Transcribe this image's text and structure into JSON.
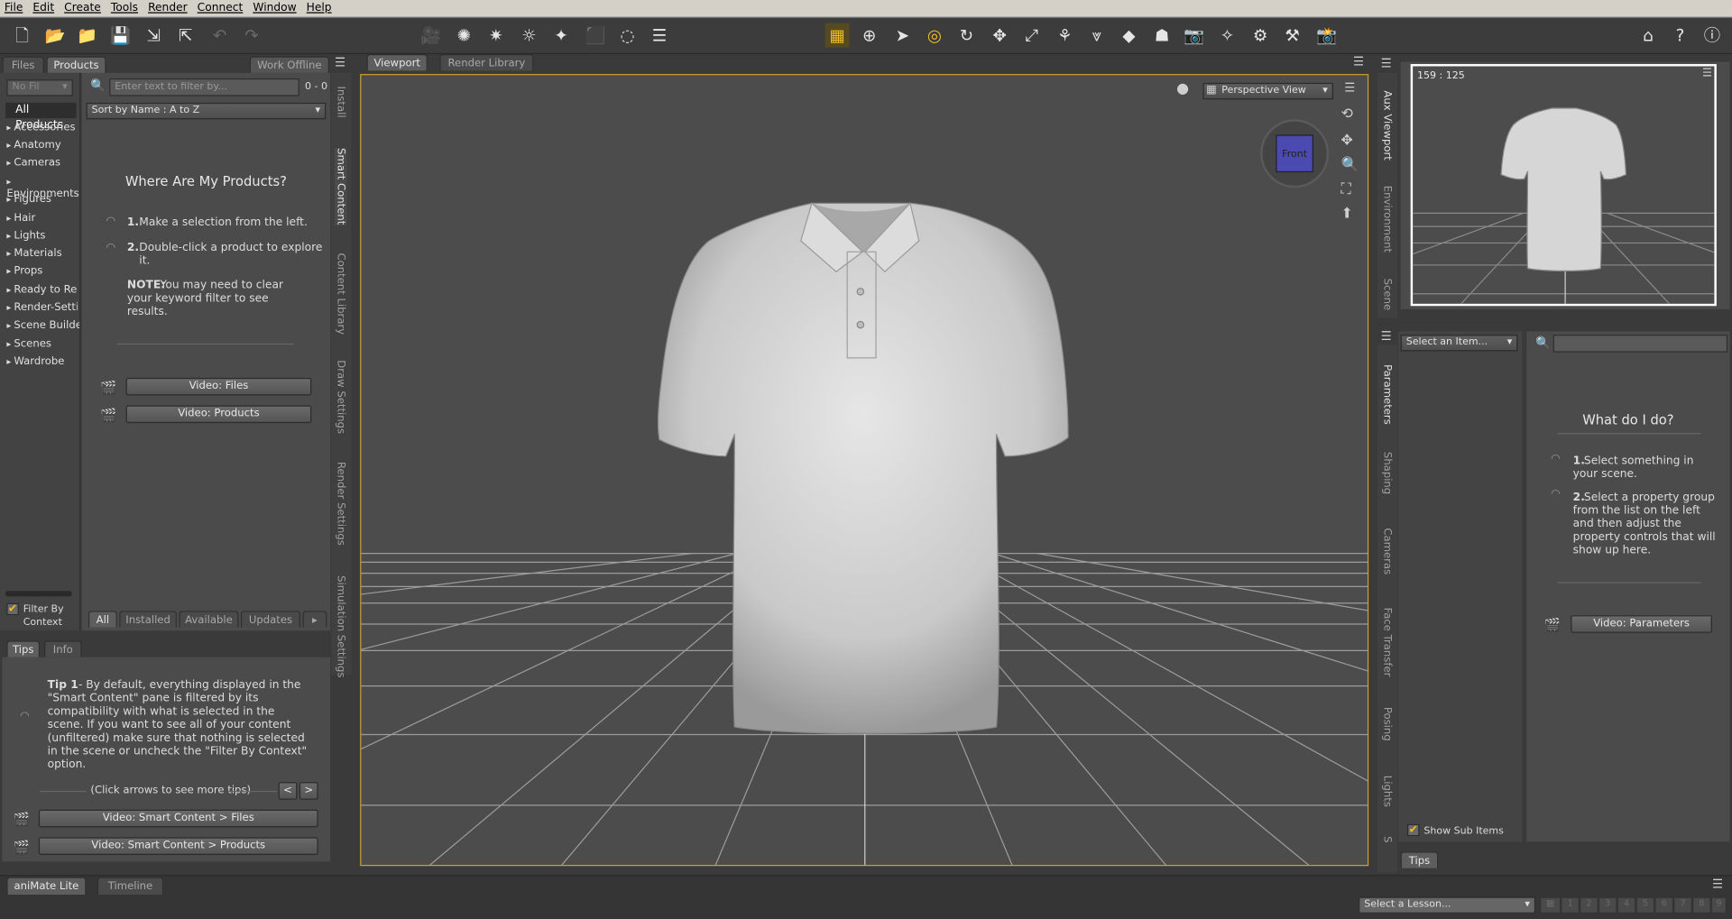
{
  "menu": [
    "File",
    "Edit",
    "Create",
    "Tools",
    "Render",
    "Connect",
    "Window",
    "Help"
  ],
  "left_tabs": {
    "files": "Files",
    "products": "Products",
    "work_offline": "Work Offline"
  },
  "left": {
    "filter_placeholder": "Enter text to filter by...",
    "filter_count": "0 - 0",
    "no_filter": "No Fil",
    "all_products": "All Products",
    "sort": "Sort by Name : A to Z",
    "categories": [
      "Accessories",
      "Anatomy",
      "Cameras",
      "Environments",
      "Figures",
      "Hair",
      "Lights",
      "Materials",
      "Props",
      "Ready to Ren",
      "Render-Settin",
      "Scene Builder",
      "Scenes",
      "Wardrobe"
    ],
    "where_title": "Where Are My Products?",
    "step1_num": "1.",
    "step1": "Make a selection from the left.",
    "step2_num": "2.",
    "step2": "Double-click a product to explore it.",
    "note_label": "NOTE:",
    "note": "You may need to clear your keyword filter to see results.",
    "video_files": "Video: Files",
    "video_products": "Video: Products",
    "filter_by": "Filter By",
    "context": "Context",
    "bottom_tabs": [
      "All",
      "Installed",
      "Available",
      "Updates"
    ]
  },
  "left_vtabs": [
    "Install",
    "Smart Content",
    "Content Library",
    "Draw Settings",
    "Render Settings",
    "Simulation Settings"
  ],
  "tips": {
    "tab_tips": "Tips",
    "tab_info": "Info",
    "tip_label": "Tip 1",
    "tip_text": "- By default, everything displayed in the \"Smart Content\" pane is filtered by its compatibility with what is selected in the scene. If you want to see all of your content (unfiltered) make sure that nothing is selected in the scene or uncheck the \"Filter By Context\" option.",
    "arrows": "(Click arrows to see more tips)",
    "prev": "<",
    "next": ">",
    "video1": "Video: Smart Content > Files",
    "video2": "Video: Smart Content > Products"
  },
  "viewport": {
    "tab_viewport": "Viewport",
    "tab_render_library": "Render Library",
    "view": "Perspective View",
    "cube_label": "Front"
  },
  "aux": {
    "coords": "159 : 125"
  },
  "right_vtabs_top": [
    "Aux Viewport",
    "Environment",
    "Scene"
  ],
  "right_vtabs": [
    "Parameters",
    "Shaping",
    "Cameras",
    "Face Transfer",
    "Posing",
    "Lights",
    "S"
  ],
  "params": {
    "select": "Select an Item...",
    "what_title": "What do I do?",
    "step1_num": "1.",
    "step1": "Select something in your scene.",
    "step2_num": "2.",
    "step2": "Select a property group from the list on the left and then adjust the property controls that will show up here.",
    "video": "Video: Parameters",
    "show_sub": "Show Sub Items",
    "tips": "Tips"
  },
  "bottom": {
    "tab_animate": "aniMate Lite",
    "tab_timeline": "Timeline",
    "lesson": "Select a Lesson...",
    "pages": [
      "1",
      "2",
      "3",
      "4",
      "5",
      "6",
      "7",
      "8",
      "9"
    ]
  },
  "colors": {
    "accent": "#d4a820",
    "cube": "#4a4ab0"
  }
}
